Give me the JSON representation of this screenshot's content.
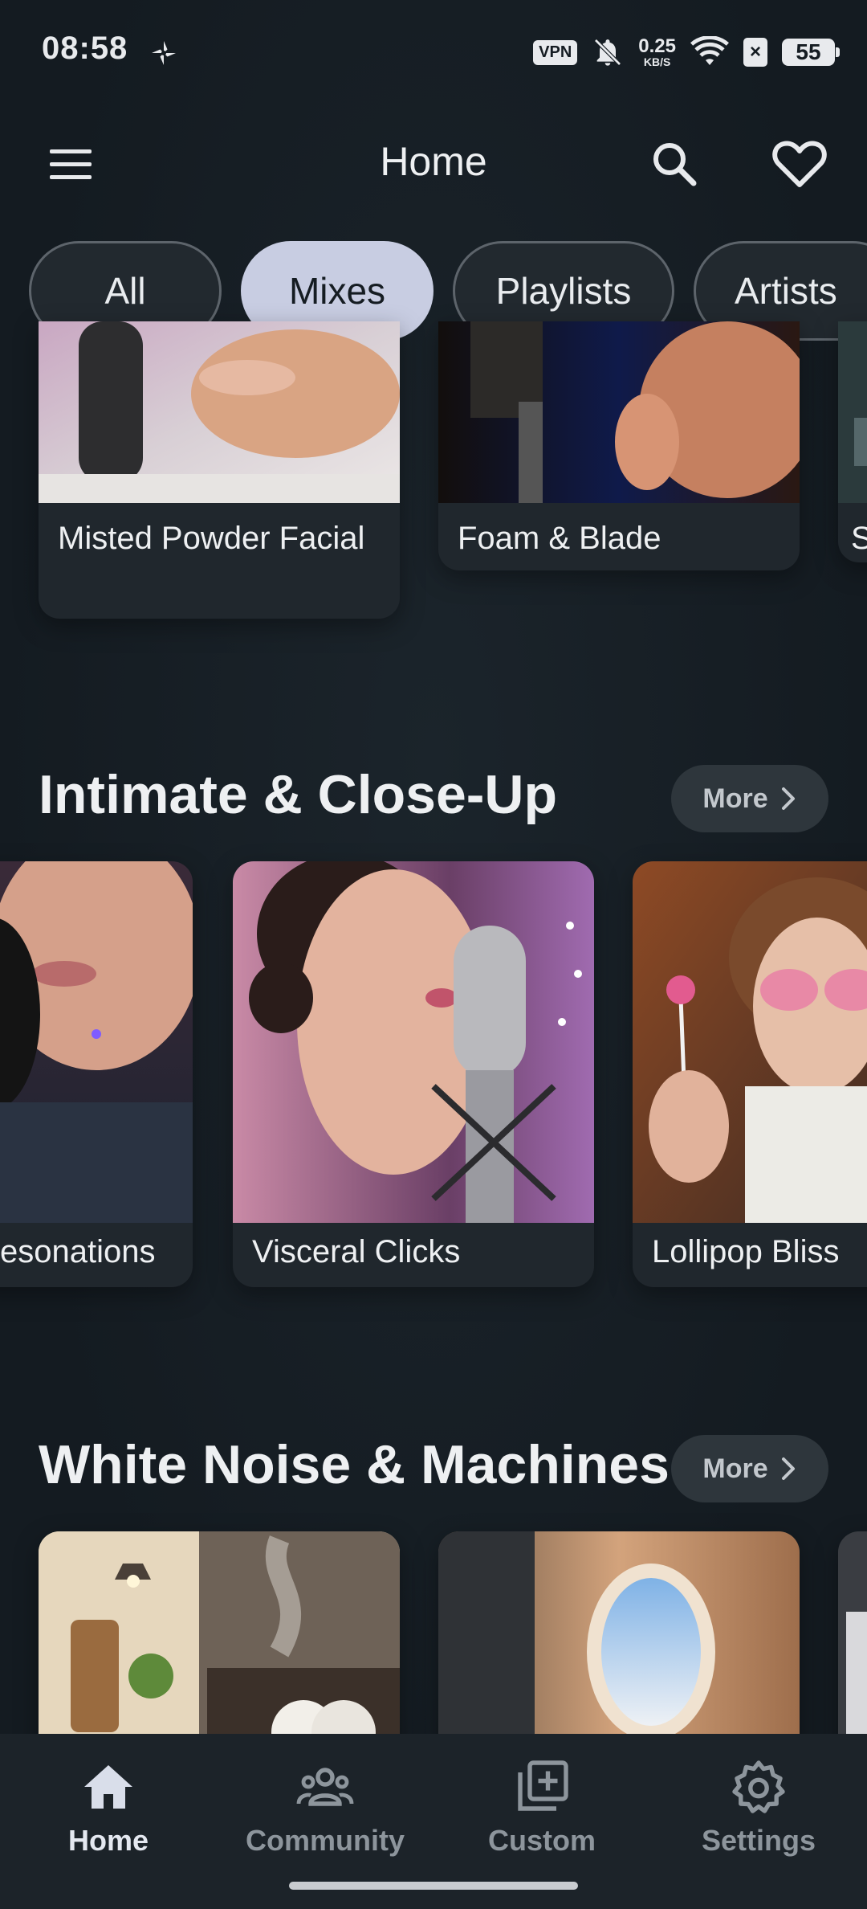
{
  "status_bar": {
    "time": "08:58",
    "vpn": "VPN",
    "net_speed_value": "0.25",
    "net_speed_unit": "KB/S",
    "sim_status": "×",
    "battery": "55",
    "icons": [
      "pinwheel-icon",
      "vpn-icon",
      "bell-off-icon",
      "wifi-icon",
      "sim-x-icon",
      "battery-icon"
    ]
  },
  "app_bar": {
    "title": "Home",
    "icons": [
      "menu-icon",
      "search-icon",
      "heart-icon"
    ]
  },
  "chips": [
    {
      "label": "All",
      "selected": false
    },
    {
      "label": "Mixes",
      "selected": true
    },
    {
      "label": "Playlists",
      "selected": false
    },
    {
      "label": "Artists",
      "selected": false
    }
  ],
  "top_row": {
    "cards": [
      {
        "label": "Misted Powder Facial"
      },
      {
        "label": "Foam & Blade"
      },
      {
        "label": "S"
      }
    ]
  },
  "sections": [
    {
      "title": "Intimate & Close-Up",
      "more_label": "More",
      "cards": [
        {
          "label": "esonations"
        },
        {
          "label": "Visceral Clicks"
        },
        {
          "label": "Lollipop Bliss"
        }
      ]
    },
    {
      "title": "White Noise & Machines",
      "more_label": "More",
      "cards": []
    }
  ],
  "bottom_nav": [
    {
      "label": "Home",
      "icon": "home-icon",
      "active": true
    },
    {
      "label": "Community",
      "icon": "community-icon",
      "active": false
    },
    {
      "label": "Custom",
      "icon": "add-box-icon",
      "active": false
    },
    {
      "label": "Settings",
      "icon": "gear-icon",
      "active": false
    }
  ],
  "colors": {
    "background": "#151c22",
    "card": "#20272d",
    "chip_selected": "#c8cde2",
    "nav_active": "#e4e8f0",
    "nav_inactive": "#8d959c"
  }
}
